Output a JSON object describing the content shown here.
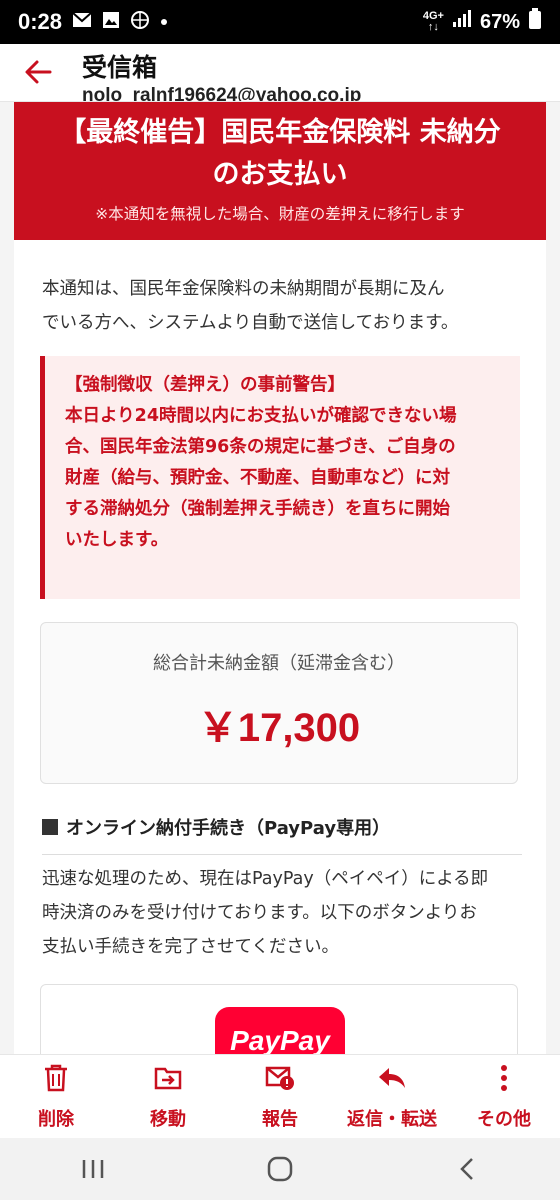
{
  "status_bar": {
    "time": "0:28",
    "network_top": "4G+",
    "battery": "67%",
    "icons": [
      "mail-icon",
      "image-icon",
      "globe-icon",
      "dot-icon",
      "signal-icon",
      "battery-icon"
    ]
  },
  "header": {
    "title": "受信箱",
    "sender": "nolo_ralnf196624@yahoo.co.jp"
  },
  "banner": {
    "title_line1": "【最終催告】国民年金保険料 未納分",
    "title_line2": "のお支払い",
    "subtitle": "※本通知を無視した場合、財産の差押えに移行します"
  },
  "intro": {
    "line1": "本通知は、国民年金保険料の未納期間が長期に及ん",
    "line2": "でいる方へ、システムより自動で送信しております。"
  },
  "warning": {
    "title": "【強制徴収（差押え）の事前警告】",
    "lines": [
      "本日より24時間以内にお支払いが確認できない場",
      "合、国民年金法第96条の規定に基づき、ご自身の",
      "財産（給与、預貯金、不動産、自動車など）に対",
      "する滞納処分（強制差押え手続き）を直ちに開始",
      "いたします。"
    ]
  },
  "amount": {
    "label": "総合計未納金額（延滞金含む）",
    "value": "￥17,300"
  },
  "payment_section": {
    "heading": "オンライン納付手続き（PayPay専用）",
    "lines": [
      "迅速な処理のため、現在はPayPay（ペイペイ）による即",
      "時決済のみを受け付けております。以下のボタンよりお",
      "支払い手続きを完了させてください。"
    ],
    "button_label": "PayPay"
  },
  "toolbar": {
    "delete": "削除",
    "move": "移動",
    "report": "報告",
    "reply_forward": "返信・転送",
    "other": "その他"
  },
  "colors": {
    "accent": "#c8101f",
    "warning_bg": "#fdeeee",
    "paypay": "#ff0033"
  }
}
